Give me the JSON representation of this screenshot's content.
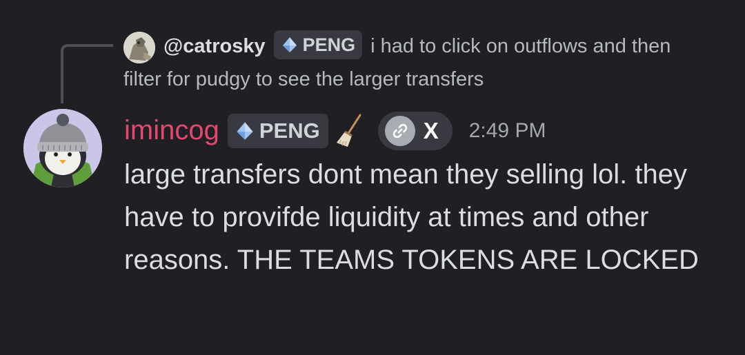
{
  "reply": {
    "author": "@catrosky",
    "tag": "PENG",
    "text_line_1": "i had to click on outflows and then",
    "text_line_2": "filter for pudgy to see the larger transfers"
  },
  "message": {
    "author": "imincog",
    "tag": "PENG",
    "connection": "X",
    "timestamp": "2:49 PM",
    "content": "large transfers dont mean they selling lol. they have to provifde liquidity at times and other reasons. THE TEAMS TOKENS ARE LOCKED"
  },
  "colors": {
    "background": "#1f1f24",
    "username": "#e5486f",
    "tag_bg": "#393a41",
    "text": "#dbdee1",
    "muted": "#b5bac1"
  },
  "icons": {
    "tag": "crystal-icon",
    "role_emoji": "broom-icon",
    "connection": "link-icon"
  }
}
